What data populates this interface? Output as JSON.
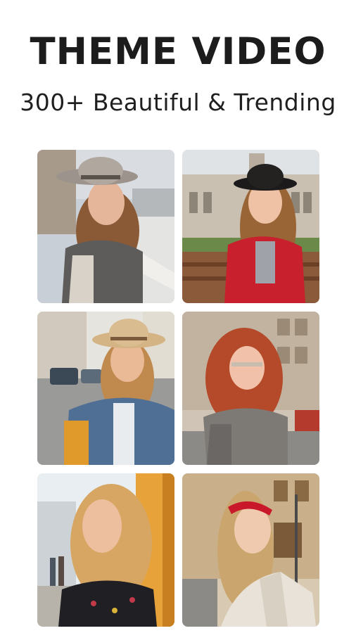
{
  "header": {
    "title": "THEME VIDEO",
    "subtitle": "300+ Beautiful & Trending"
  },
  "theme_tiles": [
    {
      "icon": "woman-gray-hat-photo"
    },
    {
      "icon": "woman-black-hat-photo"
    },
    {
      "icon": "woman-straw-hat-photo"
    },
    {
      "icon": "woman-red-hair-photo"
    },
    {
      "icon": "woman-blonde-photo"
    },
    {
      "icon": "woman-red-headband-photo"
    }
  ]
}
